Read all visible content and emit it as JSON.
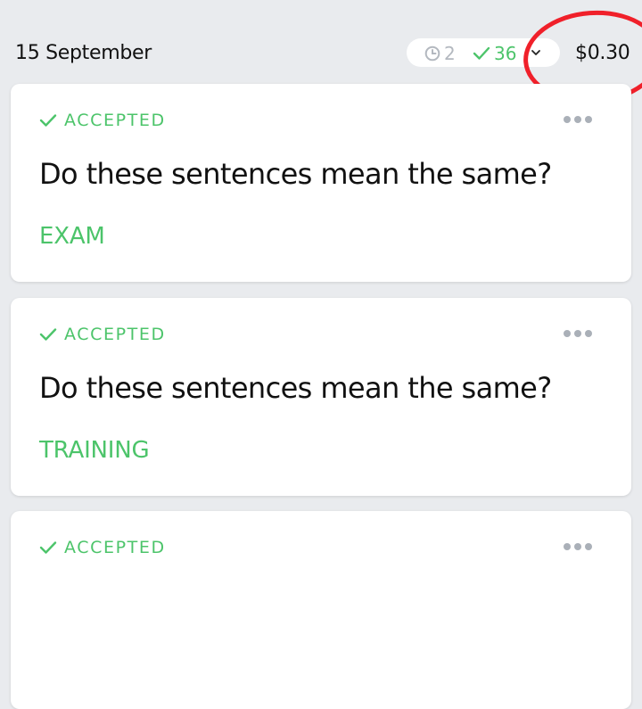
{
  "header": {
    "date": "15 September",
    "pending_count": "2",
    "accepted_count": "36",
    "earnings": "$0.30"
  },
  "colors": {
    "accent_green": "#4cc46a",
    "muted_gray": "#b3b8bf",
    "annotation_red": "#f0202a"
  },
  "icons": {
    "pending": "clock-icon",
    "accepted": "check-icon",
    "expand": "chevron-down-icon",
    "menu": "more-dots-icon"
  },
  "tasks": [
    {
      "status": "ACCEPTED",
      "title": "Do these sentences mean the same?",
      "pool": "EXAM"
    },
    {
      "status": "ACCEPTED",
      "title": "Do these sentences mean the same?",
      "pool": "TRAINING"
    },
    {
      "status": "ACCEPTED",
      "title": "",
      "pool": ""
    }
  ]
}
